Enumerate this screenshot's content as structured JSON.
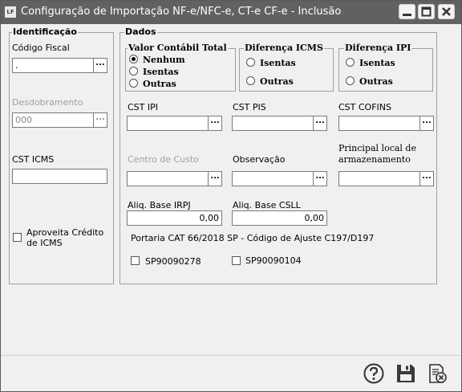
{
  "window": {
    "app_icon_text": "LF",
    "title": "Configuração de Importação NF-e/NFC-e, CT-e CF-e - Inclusão"
  },
  "identificacao": {
    "title": "Identificação",
    "codigo_fiscal_label": "Código Fiscal",
    "codigo_fiscal_value": ".",
    "desdobramento_label": "Desdobramento",
    "desdobramento_value": "000",
    "cst_icms_label": "CST ICMS",
    "cst_icms_value": "",
    "aproveita_line1": "Aproveita Crédito",
    "aproveita_line2": "de ICMS"
  },
  "dados": {
    "title": "Dados",
    "valor_contabil": {
      "title": "Valor Contábil Total",
      "options": [
        "Nenhum",
        "Isentas",
        "Outras"
      ],
      "selected": "Nenhum"
    },
    "diferenca_icms": {
      "title": "Diferença ICMS",
      "options": [
        "Isentas",
        "Outras"
      ]
    },
    "diferenca_ipi": {
      "title": "Diferença IPI",
      "options": [
        "Isentas",
        "Outras"
      ]
    },
    "cst_ipi_label": "CST IPI",
    "cst_pis_label": "CST PIS",
    "cst_cofins_label": "CST COFINS",
    "centro_custo_label": "Centro de Custo",
    "observacao_label": "Observação",
    "principal_local_line1": "Principal local de",
    "principal_local_line2": "armazenamento",
    "aliq_irpj_label": "Aliq. Base IRPJ",
    "aliq_irpj_value": "0,00",
    "aliq_csll_label": "Aliq. Base CSLL",
    "aliq_csll_value": "0,00",
    "portaria_text": "Portaria CAT 66/2018 SP - Código de Ajuste C197/D197",
    "sp1_label": "SP90090278",
    "sp2_label": "SP90090104"
  },
  "ellipsis": "...",
  "colors": {
    "titlebar": "#616161",
    "window_bg": "#f0f0f0",
    "border": "#a0a0a0"
  },
  "icons": [
    "minimize-icon",
    "maximize-icon",
    "close-icon",
    "help-icon",
    "save-icon",
    "cancel-doc-icon"
  ]
}
